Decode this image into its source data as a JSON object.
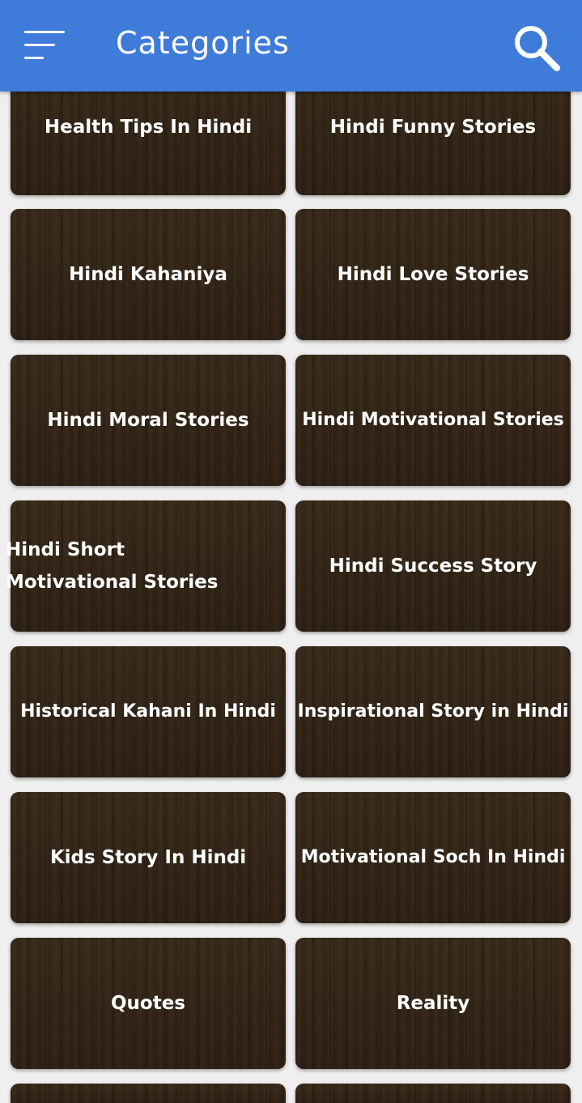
{
  "appbar": {
    "title": "Categories",
    "menu_icon": "hamburger-menu-icon",
    "search_icon": "search-icon"
  },
  "categories": [
    "Health Tips In Hindi",
    "Hindi Funny Stories",
    "Hindi Kahaniya",
    "Hindi Love Stories",
    "Hindi Moral Stories",
    "Hindi Motivational Stories",
    "Hindi Short Motivational Stories",
    "Hindi Success Story",
    "Historical Kahani In Hindi",
    "Inspirational Story in Hindi",
    "Kids Story In Hindi",
    "Motivational Soch In Hindi",
    "Quotes",
    "Reality"
  ],
  "colors": {
    "appbar": "#3f7bd9",
    "tile": "#2f2216",
    "background": "#efefef",
    "text": "#ffffff"
  }
}
